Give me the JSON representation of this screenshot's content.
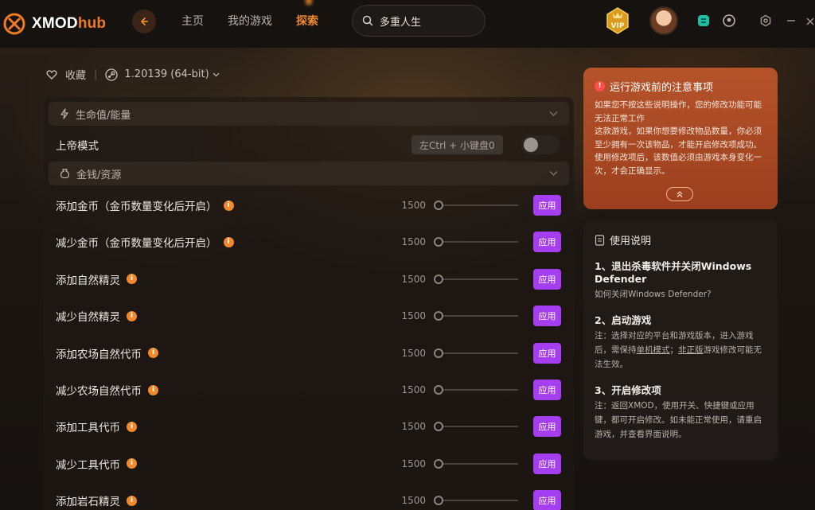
{
  "app": {
    "logo_text": "XMOD",
    "logo_hub": "hub"
  },
  "nav": {
    "home": "主页",
    "my_games": "我的游戏",
    "explore": "探索"
  },
  "search": {
    "value": "多重人生"
  },
  "version_row": {
    "favorite": "收藏",
    "version": "1.20139 (64-bit)"
  },
  "sections": [
    {
      "title": "生命值/能量"
    },
    {
      "title": "金钱/资源"
    }
  ],
  "god_mode": {
    "label": "上帝模式",
    "hotkey": "左Ctrl + 小键盘0",
    "enabled": false
  },
  "apply_label": "应用",
  "info_glyph": "i",
  "rows": [
    {
      "label": "添加金币（金币数量变化后开启）",
      "value": "1500",
      "slider": 0
    },
    {
      "label": "减少金币（金币数量变化后开启）",
      "value": "1500",
      "slider": 0
    },
    {
      "label": "添加自然精灵",
      "value": "1500",
      "slider": 0
    },
    {
      "label": "减少自然精灵",
      "value": "1500",
      "slider": 0
    },
    {
      "label": "添加农场自然代币",
      "value": "1500",
      "slider": 0
    },
    {
      "label": "减少农场自然代币",
      "value": "1500",
      "slider": 0
    },
    {
      "label": "添加工具代币",
      "value": "1500",
      "slider": 0
    },
    {
      "label": "减少工具代币",
      "value": "1500",
      "slider": 0
    },
    {
      "label": "添加岩石精灵",
      "value": "1500",
      "slider": 0
    }
  ],
  "warning": {
    "badge": "!",
    "title": "运行游戏前的注意事项",
    "text_1": "如果您不按这些说明操作，您的修改功能可能无法正常工作",
    "text_2": "这款游戏，如果你想要修改物品数量，你必须至少拥有一次该物品，才能开启修改项成功。使用修改项后，该数值必须由游戏本身变化一次，才会正确显示。"
  },
  "guide": {
    "title": "使用说明",
    "step1_title": "1、退出杀毒软件并关闭Windows Defender",
    "step1_text": "如何关闭Windows Defender?",
    "step2_title": "2、启动游戏",
    "step2_text_a": "注：选择对应的平台和游戏版本，进入游戏后，需保持",
    "step2_link1": "单机模式",
    "step2_text_b": "；",
    "step2_link2": "非正版",
    "step2_text_c": "游戏修改可能无法生效。",
    "step3_title": "3、开启修改项",
    "step3_text": "注：返回XMOD，使用开关、快捷键或应用键，都可开启修改。如未能正常使用，请重启游戏，并查看界面说明。"
  },
  "colors": {
    "accent": "#f08a2c",
    "apply": "#a53df0",
    "warning_bg": "#b5532a"
  }
}
